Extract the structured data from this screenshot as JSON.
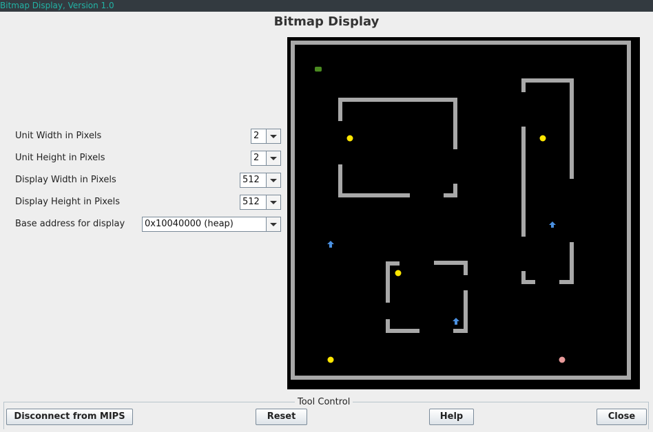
{
  "window": {
    "title": "Bitmap Display, Version 1.0"
  },
  "heading": "Bitmap Display",
  "settings": [
    {
      "label": "Unit Width in Pixels",
      "value": "2"
    },
    {
      "label": "Unit Height in Pixels",
      "value": "2"
    },
    {
      "label": "Display Width in Pixels",
      "value": "512"
    },
    {
      "label": "Display Height in Pixels",
      "value": "512"
    },
    {
      "label": "Base address for display",
      "value": "0x10040000 (heap)"
    }
  ],
  "bitmap": {
    "background": "#000000",
    "wall_color": "#a8a8a8",
    "player_color": "#4a8a20",
    "coin_color": "#ffe600",
    "enemy_color": "#4a90e0",
    "goal_color": "#e89a9a"
  },
  "tool_control": {
    "legend": "Tool Control",
    "disconnect": "Disconnect from MIPS",
    "reset": "Reset",
    "help": "Help",
    "close": "Close"
  }
}
